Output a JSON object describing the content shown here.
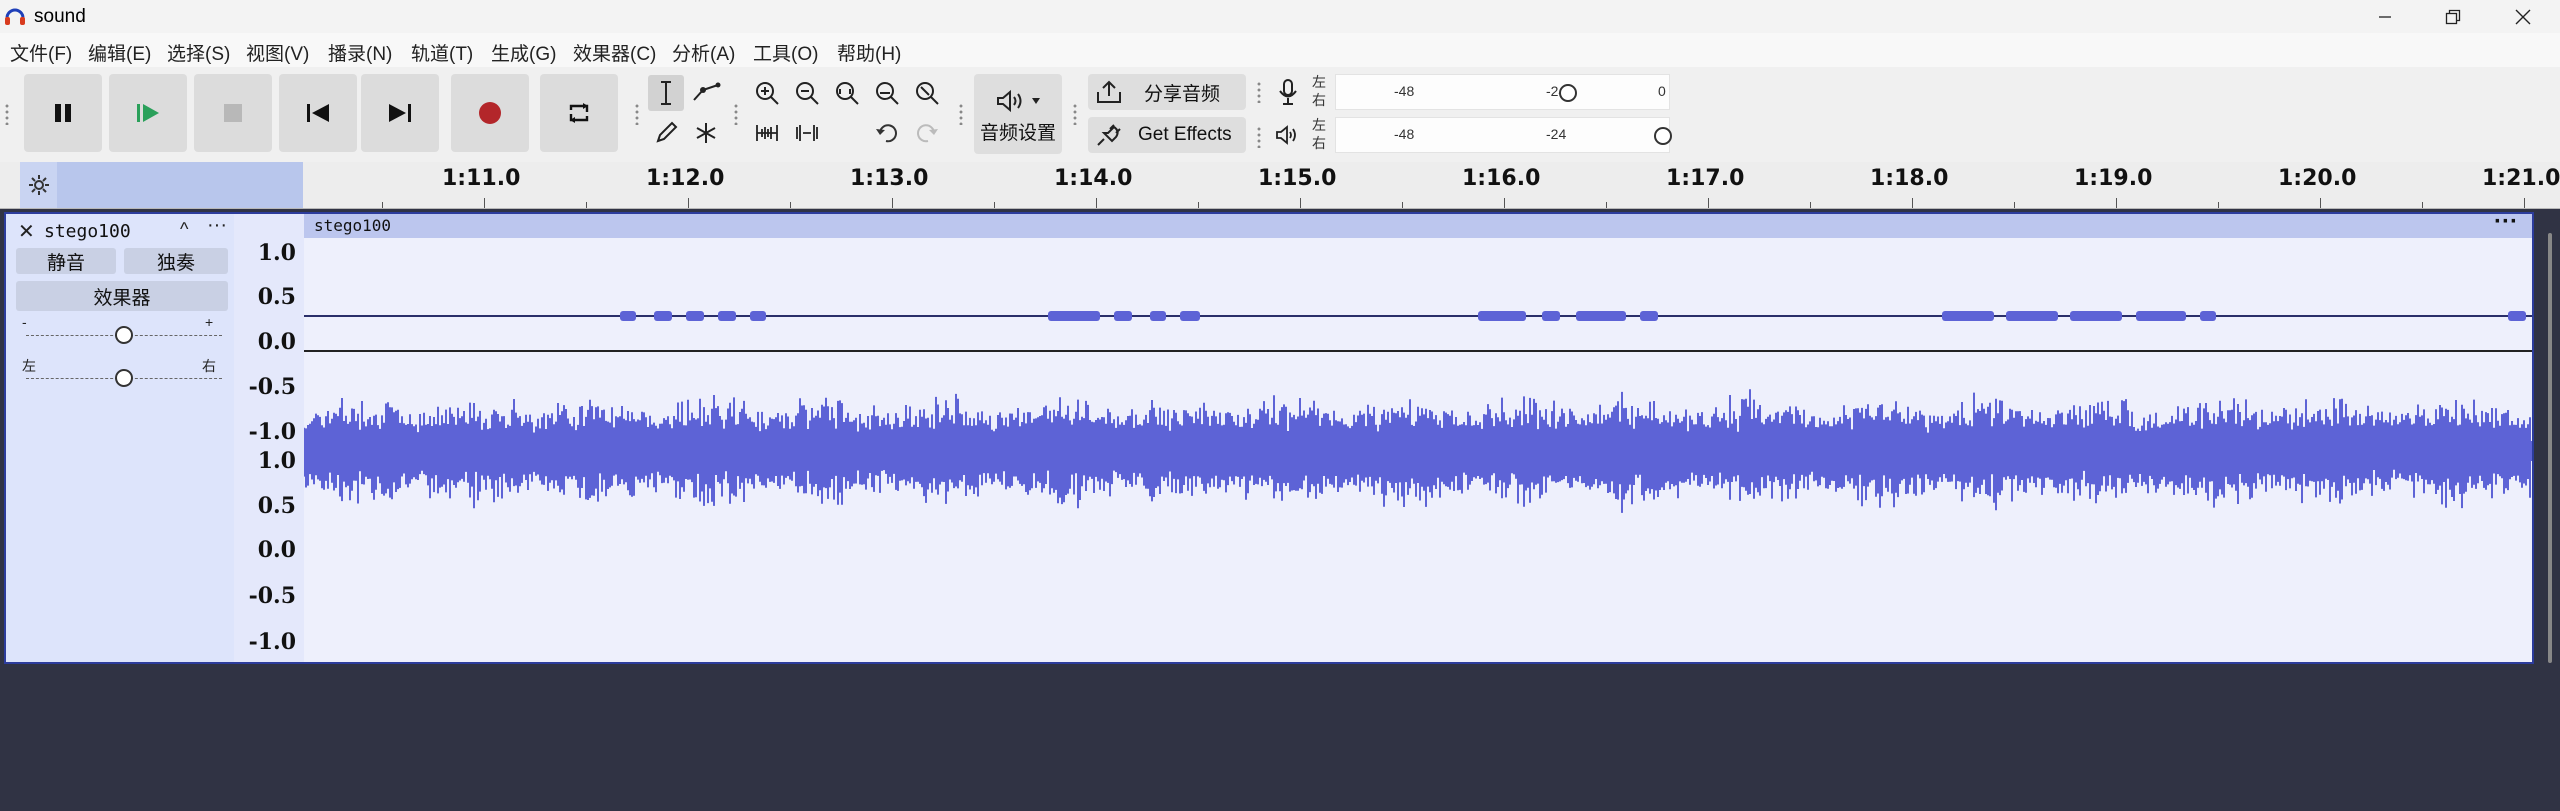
{
  "window": {
    "title": "sound",
    "controls": {
      "minimize": "minimize-icon",
      "maximize": "restore-icon",
      "close": "close-icon"
    }
  },
  "menu": [
    "文件(F)",
    "编辑(E)",
    "选择(S)",
    "视图(V)",
    "播录(N)",
    "轨道(T)",
    "生成(G)",
    "效果器(C)",
    "分析(A)",
    "工具(O)",
    "帮助(H)"
  ],
  "toolbar": {
    "share_audio": "分享音频",
    "get_effects": "Get Effects",
    "audio_settings": "音频设置"
  },
  "meters": {
    "record": {
      "left": "左",
      "right": "右",
      "ticks": [
        "-48",
        "-24",
        "0"
      ]
    },
    "playback": {
      "left": "左",
      "right": "右",
      "ticks": [
        "-48",
        "-24",
        ""
      ]
    }
  },
  "ruler": {
    "labels": [
      "1:11.0",
      "1:12.0",
      "1:13.0",
      "1:14.0",
      "1:15.0",
      "1:16.0",
      "1:17.0",
      "1:18.0",
      "1:19.0",
      "1:20.0",
      "1:21.0"
    ]
  },
  "track": {
    "name": "stego100",
    "clip_name": "stego100",
    "mute": "静音",
    "solo": "独奏",
    "effects": "效果器",
    "gain_minus": "-",
    "gain_plus": "+",
    "pan_left": "左",
    "pan_right": "右",
    "gain_level": 0.5,
    "pan_level": 0.5,
    "scale_top": [
      "1.0",
      "0.5",
      "0.0",
      "-0.5",
      "-1.0"
    ],
    "scale_bottom": [
      "1.0",
      "0.5",
      "0.0",
      "-0.5",
      "-1.0"
    ]
  },
  "colors": {
    "waveform": "#5d63d6",
    "record_button": "#b3262a",
    "selection": "#b8c6ec",
    "track_border": "#2c3c9c"
  }
}
